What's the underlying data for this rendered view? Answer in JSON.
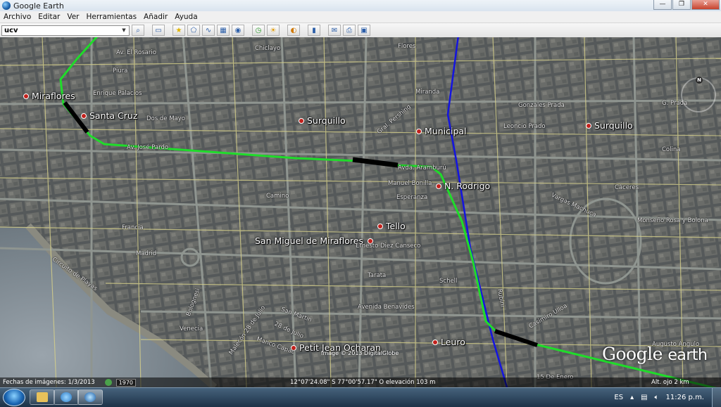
{
  "window": {
    "title": "Google Earth",
    "minimize": "—",
    "maximize": "❐",
    "close": "✕"
  },
  "menu": [
    "Archivo",
    "Editar",
    "Ver",
    "Herramientas",
    "Añadir",
    "Ayuda"
  ],
  "search": {
    "value": "ucv"
  },
  "places": [
    {
      "name": "Miraflores"
    },
    {
      "name": "Santa Cruz"
    },
    {
      "name": "Surquillo"
    },
    {
      "name": "Municipal"
    },
    {
      "name": "Surquillo"
    },
    {
      "name": "N. Rodrigo"
    },
    {
      "name": "Tello"
    },
    {
      "name": "San Miguel de Miraflores"
    },
    {
      "name": "Petit Jean Ocharan"
    },
    {
      "name": "Leuro"
    }
  ],
  "streets": [
    "Av. El Rosario",
    "Chiclayo",
    "Piura",
    "Flores",
    "Enrique Palacios",
    "Miranda",
    "Dos de Mayo",
    "Gral. Pershing",
    "Gonzales Prada",
    "G. Prada",
    "Leoncio Prado",
    "Colina",
    "Av. José Pardo",
    "Avda. Aramburú",
    "Manuel Bonilla",
    "Esperanza",
    "Cáceres",
    "Camino",
    "Vargas Machuca",
    "Monseño Rosa y Bolona",
    "Francia",
    "Madrid",
    "Ernesto Diez Canseco",
    "Tarata",
    "Schell",
    "Circuito de Playas",
    "Avenida Benavides",
    "San Martin",
    "28 de Julio",
    "Manco Capac",
    "Malecón 28 de Julio",
    "Casimiro Ulloa",
    "Augusto Angulo",
    "15 De Enero",
    "Bolognesi",
    "Venecia",
    "Rubini"
  ],
  "map": {
    "brand_google": "Google",
    "brand_earth": "earth",
    "copyright": "Image © 2013 DigitalGlobe",
    "compass": "N"
  },
  "status": {
    "image_date": "Fechas de imágenes: 1/3/2013",
    "year": "1970",
    "coords": "12°07'24.08\" S  77°00'57.17\" O elevación  103 m",
    "alt": "Alt. ojo  2 km"
  },
  "tray": {
    "lang": "ES",
    "time": "11:26 p.m."
  },
  "colors": {
    "route_green": "#1fdc2a",
    "route_blue": "#1414e0",
    "segment_black": "#000000"
  }
}
